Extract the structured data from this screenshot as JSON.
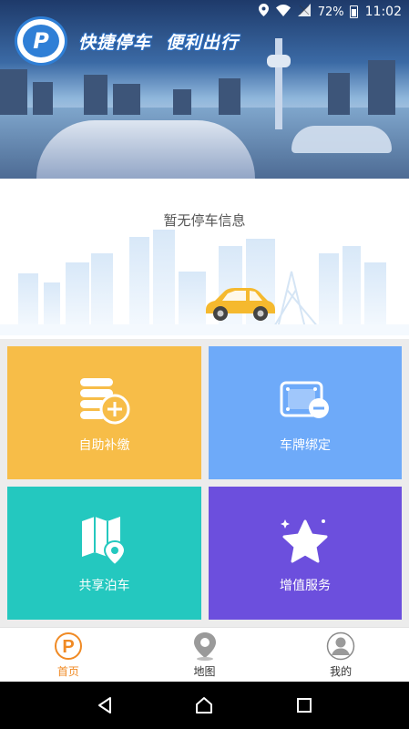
{
  "status_bar": {
    "battery": "72%",
    "time": "11:02"
  },
  "banner": {
    "logo_letter": "P",
    "slogan": [
      "快捷停车",
      "便利出行"
    ]
  },
  "parking": {
    "empty_text": "暂无停车信息"
  },
  "tiles": [
    {
      "label": "自助补缴",
      "icon": "coins-plus-icon",
      "color": "#f7bd48"
    },
    {
      "label": "车牌绑定",
      "icon": "license-plate-icon",
      "color": "#6eaaf9"
    },
    {
      "label": "共享泊车",
      "icon": "map-pin-icon",
      "color": "#24c8bf"
    },
    {
      "label": "增值服务",
      "icon": "star-icon",
      "color": "#6c4fdd"
    }
  ],
  "tabs": [
    {
      "label": "首页",
      "icon": "parking-p-icon",
      "active": true
    },
    {
      "label": "地图",
      "icon": "location-pin-icon",
      "active": false
    },
    {
      "label": "我的",
      "icon": "user-avatar-icon",
      "active": false
    }
  ],
  "colors": {
    "accent": "#f08a24",
    "brand_blue": "#2f7fd6"
  }
}
